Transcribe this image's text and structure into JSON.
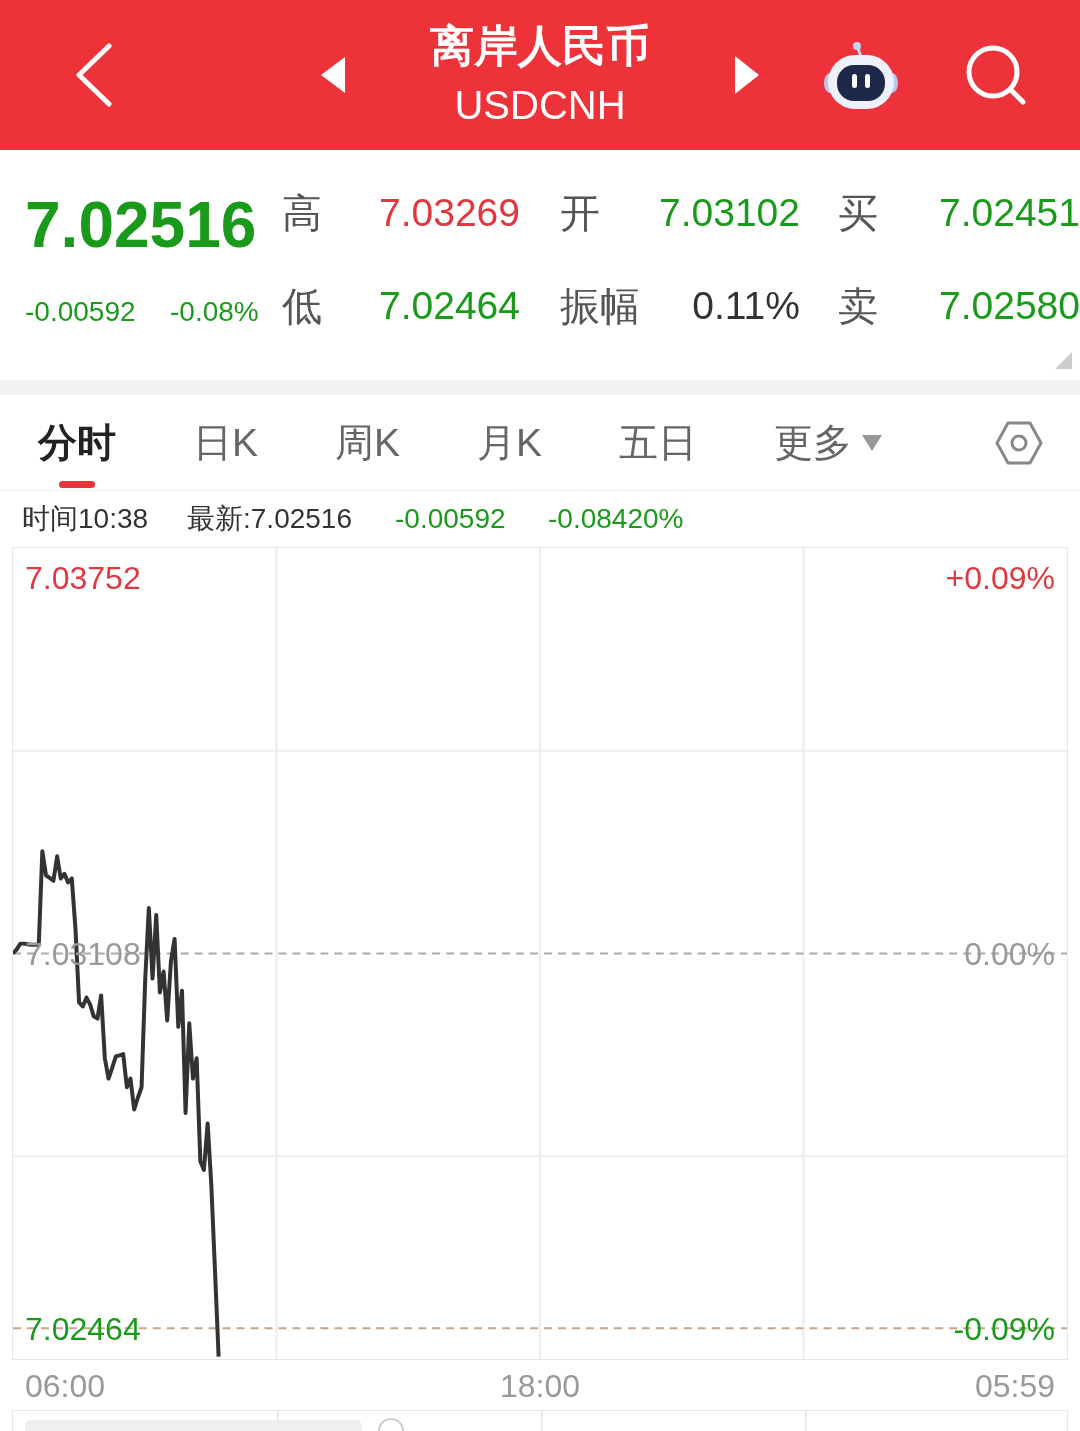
{
  "header": {
    "title": "离岸人民币",
    "subtitle": "USDCNH"
  },
  "quote": {
    "price": "7.02516",
    "change": "-0.00592",
    "change_percent": "-0.08%",
    "rows": [
      [
        {
          "label": "高",
          "value": "7.03269",
          "color": "#e0383e"
        },
        {
          "label": "开",
          "value": "7.03102",
          "color": "#1a9a1a"
        },
        {
          "label": "买",
          "value": "7.02451",
          "color": "#1a9a1a"
        }
      ],
      [
        {
          "label": "低",
          "value": "7.02464",
          "color": "#1a9a1a"
        },
        {
          "label": "振幅",
          "value": "0.11%",
          "color": "#333333"
        },
        {
          "label": "卖",
          "value": "7.02580",
          "color": "#1a9a1a"
        }
      ]
    ]
  },
  "tabs": [
    {
      "label": "分时",
      "selected": true,
      "kind": "tab"
    },
    {
      "label": "日K",
      "selected": false,
      "kind": "tab"
    },
    {
      "label": "周K",
      "selected": false,
      "kind": "tab"
    },
    {
      "label": "月K",
      "selected": false,
      "kind": "tab"
    },
    {
      "label": "五日",
      "selected": false,
      "kind": "tab"
    },
    {
      "label": "更多",
      "selected": false,
      "kind": "dropdown"
    }
  ],
  "info_line": {
    "time": "时间10:38",
    "latest": "最新:7.02516",
    "change": "-0.00592",
    "change_percent": "-0.08420%"
  },
  "chart": {
    "chart_data": {
      "type": "line",
      "categories": [
        null,
        null,
        null,
        null,
        null,
        null,
        null,
        null,
        null,
        null,
        null,
        null,
        null,
        null,
        null,
        null,
        null,
        null,
        null,
        null,
        null,
        null,
        null,
        null,
        null,
        null,
        null,
        null,
        null,
        null,
        null,
        null,
        null,
        null,
        null,
        null,
        null,
        null,
        null,
        null,
        null,
        null,
        null,
        null,
        null,
        null,
        null,
        null,
        null,
        null,
        null,
        null,
        null,
        null,
        null,
        null,
        null,
        null,
        null,
        null,
        null,
        null,
        null,
        null,
        null,
        null,
        null,
        null,
        null,
        null,
        null,
        null,
        null,
        null,
        null,
        null,
        null,
        null,
        null,
        null,
        null,
        null,
        null,
        null,
        null,
        null,
        null,
        null,
        null,
        null,
        null,
        null,
        null,
        null,
        null,
        null,
        null,
        null,
        null,
        null,
        null,
        null,
        null,
        null,
        null,
        null,
        null,
        null,
        null,
        null,
        null,
        null,
        null,
        null,
        null,
        null,
        null,
        null,
        null,
        null,
        null,
        null,
        null,
        null,
        null,
        null,
        null,
        null,
        null,
        null,
        null,
        null,
        null,
        null,
        null,
        null,
        null,
        null,
        null,
        null,
        null,
        null,
        null,
        null,
        null,
        null,
        null,
        null,
        null,
        null,
        null,
        null,
        null,
        null,
        null,
        null,
        null,
        null,
        null,
        null,
        null,
        null,
        null,
        null,
        null,
        null,
        null,
        null,
        null,
        null,
        null,
        null,
        null,
        null,
        null,
        null,
        null,
        null,
        null,
        null,
        null,
        null,
        null,
        null,
        null,
        null,
        null,
        null,
        null,
        null,
        null,
        null,
        null,
        null,
        null,
        null,
        null,
        null,
        null,
        null,
        null,
        null,
        null,
        null,
        null,
        null,
        null,
        null,
        null,
        null,
        null,
        null,
        null,
        null,
        null,
        null,
        null,
        null,
        null,
        null,
        null,
        null,
        null,
        null,
        null,
        null,
        null,
        null,
        null,
        null,
        null,
        null,
        null,
        null,
        null,
        null,
        null,
        null,
        null,
        null,
        null,
        null,
        null,
        null,
        null,
        null,
        null,
        null,
        null,
        null,
        null,
        null,
        null,
        null,
        null,
        null,
        null,
        null,
        null,
        null,
        null,
        null,
        null,
        null,
        null,
        null,
        null,
        null,
        null,
        null,
        null,
        null,
        null,
        null,
        null,
        null,
        null,
        null,
        null,
        null,
        null,
        null,
        null,
        null,
        null,
        null,
        null,
        null
      ],
      "series": [
        {
          "color": "#333333",
          "values": [
            7.03108,
            7.03115,
            7.03125,
            7.03125,
            7.03124,
            7.03123,
            7.03123,
            7.03123,
            7.03284,
            7.03242,
            7.03238,
            7.03233,
            7.03275,
            7.03237,
            7.03245,
            7.0323,
            7.03237,
            7.0315,
            7.03024,
            7.03017,
            7.03032,
            7.0302,
            7.03,
            7.02996,
            7.03036,
            7.02928,
            7.02893,
            7.02911,
            7.02931,
            7.02933,
            7.02935,
            7.02878,
            7.02893,
            7.0284,
            7.0286,
            7.02878,
            7.03065,
            7.03186,
            7.03065,
            7.03174,
            7.03041,
            7.03077,
            7.02993,
            7.03094,
            7.03133,
            7.02982,
            7.03044,
            7.02834,
            7.02988,
            7.02893,
            7.02928,
            7.02751,
            7.02736,
            7.02816,
            7.0271,
            7.02562,
            7.02415,
            null,
            null,
            null,
            null,
            null,
            null,
            null,
            null,
            null,
            null,
            null,
            null,
            null,
            null,
            null,
            null,
            null,
            null,
            null,
            null,
            null,
            null,
            null,
            null,
            null,
            null,
            null,
            null,
            null,
            null,
            null,
            null,
            null,
            null,
            null,
            null,
            null,
            null,
            null,
            null,
            null,
            null,
            null,
            null,
            null,
            null,
            null,
            null,
            null,
            null,
            null,
            null,
            null,
            null,
            null,
            null,
            null,
            null,
            null,
            null,
            null,
            null,
            null,
            null,
            null,
            null,
            null,
            null,
            null,
            null,
            null,
            null,
            null,
            null,
            null,
            null,
            null,
            null,
            null,
            null,
            null,
            null,
            null,
            null,
            null,
            null,
            null,
            null,
            null,
            null,
            null,
            null,
            null,
            null,
            null,
            null,
            null,
            null,
            null,
            null,
            null,
            null,
            null,
            null,
            null,
            null,
            null,
            null,
            null,
            null,
            null,
            null,
            null,
            null,
            null,
            null,
            null,
            null,
            null,
            null,
            null,
            null,
            null,
            null,
            null,
            null,
            null,
            null,
            null,
            null,
            null,
            null,
            null,
            null,
            null,
            null,
            null,
            null,
            null,
            null,
            null,
            null,
            null,
            null,
            null,
            null,
            null,
            null,
            null,
            null,
            null,
            null,
            null,
            null,
            null,
            null,
            null,
            null,
            null,
            null,
            null,
            null,
            null,
            null,
            null,
            null,
            null,
            null,
            null,
            null,
            null,
            null,
            null,
            null,
            null,
            null,
            null,
            null,
            null,
            null,
            null,
            null,
            null,
            null,
            null,
            null,
            null,
            null,
            null,
            null,
            null,
            null,
            null,
            null,
            null,
            null,
            null,
            null,
            null,
            null,
            null,
            null,
            null,
            null,
            null,
            null,
            null,
            null,
            null,
            null,
            null,
            null,
            null,
            null,
            null,
            null,
            null,
            null,
            null,
            null,
            null,
            null,
            null,
            null,
            null,
            null,
            null,
            null,
            null,
            null,
            null
          ]
        }
      ],
      "ylim": [
        7.02411,
        7.03805
      ],
      "yticks": [
        {
          "value": 7.03752,
          "label": "7.03752"
        },
        {
          "value": 7.03108,
          "label": "7.03108"
        },
        {
          "value": 7.02464,
          "label": "7.02464"
        }
      ],
      "ref_lines": [
        {
          "axis": "y",
          "value": 7.03108
        },
        {
          "axis": "y",
          "value": 7.02464
        }
      ]
    },
    "right_axis_labels": [
      "+0.09%",
      "0.00%",
      "-0.09%"
    ],
    "time_axis_labels": [
      "06:00",
      "18:00",
      "05:59"
    ]
  }
}
